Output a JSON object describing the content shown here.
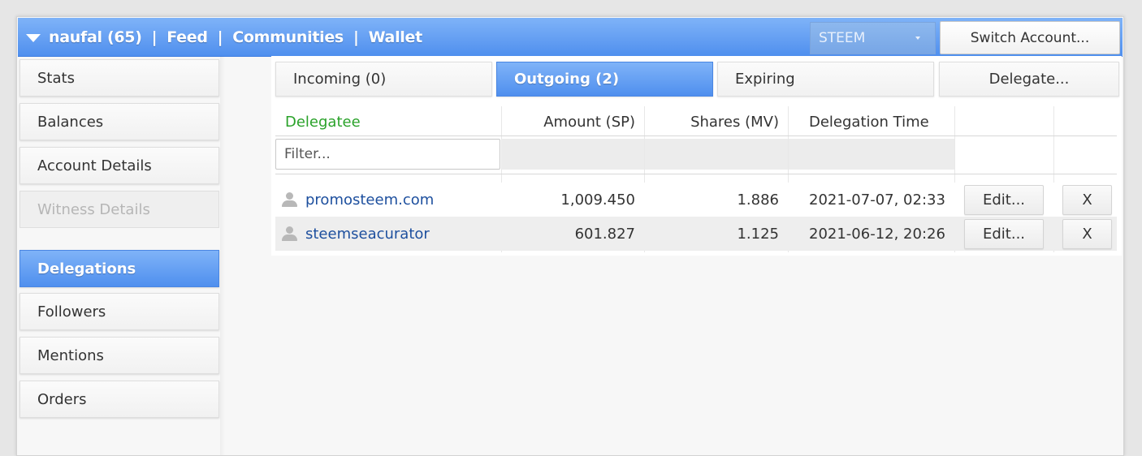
{
  "header": {
    "account": "naufal (65)",
    "links": [
      "Feed",
      "Communities",
      "Wallet"
    ],
    "separator": "|",
    "currency": "STEEM",
    "switch_account": "Switch Account..."
  },
  "sidebar": {
    "items": [
      {
        "label": "Stats"
      },
      {
        "label": "Balances"
      },
      {
        "label": "Account Details"
      },
      {
        "label": "Witness Details"
      },
      {
        "label": "Delegations"
      },
      {
        "label": "Followers"
      },
      {
        "label": "Mentions"
      },
      {
        "label": "Orders"
      }
    ]
  },
  "tabs": [
    {
      "label": "Incoming (0)"
    },
    {
      "label": "Outgoing (2)"
    },
    {
      "label": "Expiring"
    },
    {
      "label": "Delegate..."
    }
  ],
  "table": {
    "columns": [
      "Delegatee",
      "Amount (SP)",
      "Shares (MV)",
      "Delegation Time"
    ],
    "filter_placeholder": "Filter...",
    "rows": [
      {
        "delegatee": "promosteem.com",
        "amount": "1,009.450",
        "shares": "1.886",
        "time": "2021-07-07, 02:33",
        "edit": "Edit...",
        "remove": "X"
      },
      {
        "delegatee": "steemseacurator",
        "amount": "601.827",
        "shares": "1.125",
        "time": "2021-06-12, 20:26",
        "edit": "Edit...",
        "remove": "X"
      }
    ]
  },
  "colors": {
    "accent": "#4f8fee",
    "delegatee_header": "#2aa22a",
    "link": "#1d4f9e"
  }
}
